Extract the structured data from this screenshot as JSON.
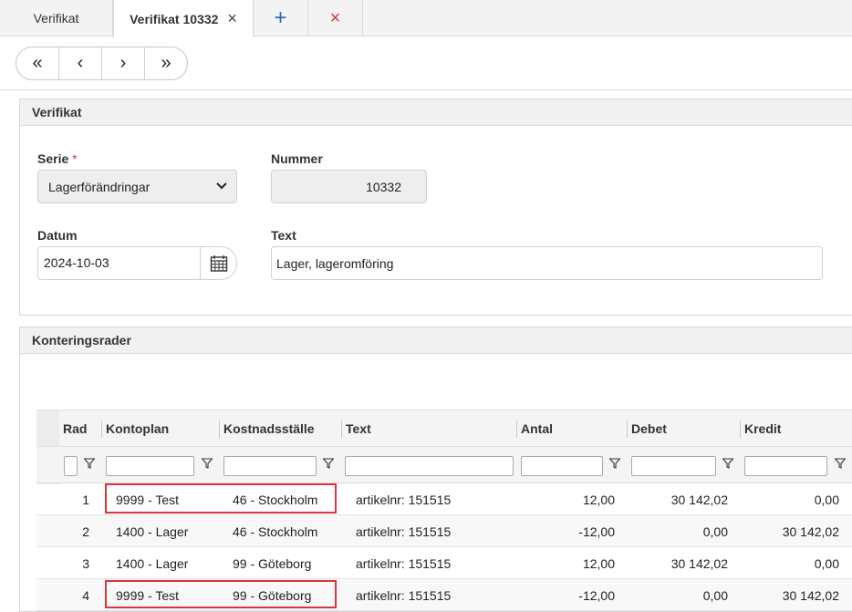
{
  "tabs": [
    {
      "label": "Verifikat"
    },
    {
      "label": "Verifikat 10332",
      "close": "×"
    },
    {
      "label": "+"
    },
    {
      "label": "×"
    }
  ],
  "pager": {
    "first": "«",
    "prev": "‹",
    "next": "›",
    "last": "»"
  },
  "verifikat_panel": {
    "title": "Verifikat",
    "serie_label": "Serie",
    "required_mark": "*",
    "serie_value": "Lagerförändringar",
    "nummer_label": "Nummer",
    "nummer_value": "10332",
    "datum_label": "Datum",
    "datum_value": "2024-10-03",
    "text_label": "Text",
    "text_value": "Lager, lageromföring"
  },
  "kontering_panel": {
    "title": "Konteringsrader",
    "columns": [
      "Rad",
      "Kontoplan",
      "Kostnadsställe",
      "Text",
      "Antal",
      "Debet",
      "Kredit"
    ],
    "rows": [
      {
        "rad": "1",
        "kontoplan": "9999 - Test",
        "kostnadsstalle": "46 - Stockholm",
        "text": "artikelnr: 151515",
        "antal": "12,00",
        "debet": "30 142,02",
        "kredit": "0,00"
      },
      {
        "rad": "2",
        "kontoplan": "1400 - Lager",
        "kostnadsstalle": "46 - Stockholm",
        "text": "artikelnr: 151515",
        "antal": "-12,00",
        "debet": "0,00",
        "kredit": "30 142,02"
      },
      {
        "rad": "3",
        "kontoplan": "1400 - Lager",
        "kostnadsstalle": "99 - Göteborg",
        "text": "artikelnr: 151515",
        "antal": "12,00",
        "debet": "30 142,02",
        "kredit": "0,00"
      },
      {
        "rad": "4",
        "kontoplan": "9999 - Test",
        "kostnadsstalle": "99 - Göteborg",
        "text": "artikelnr: 151515",
        "antal": "-12,00",
        "debet": "0,00",
        "kredit": "30 142,02"
      }
    ]
  },
  "colors": {
    "accent_blue": "#2a6ebb",
    "danger_red": "#d23a3a",
    "highlight_red": "#d9363e"
  }
}
